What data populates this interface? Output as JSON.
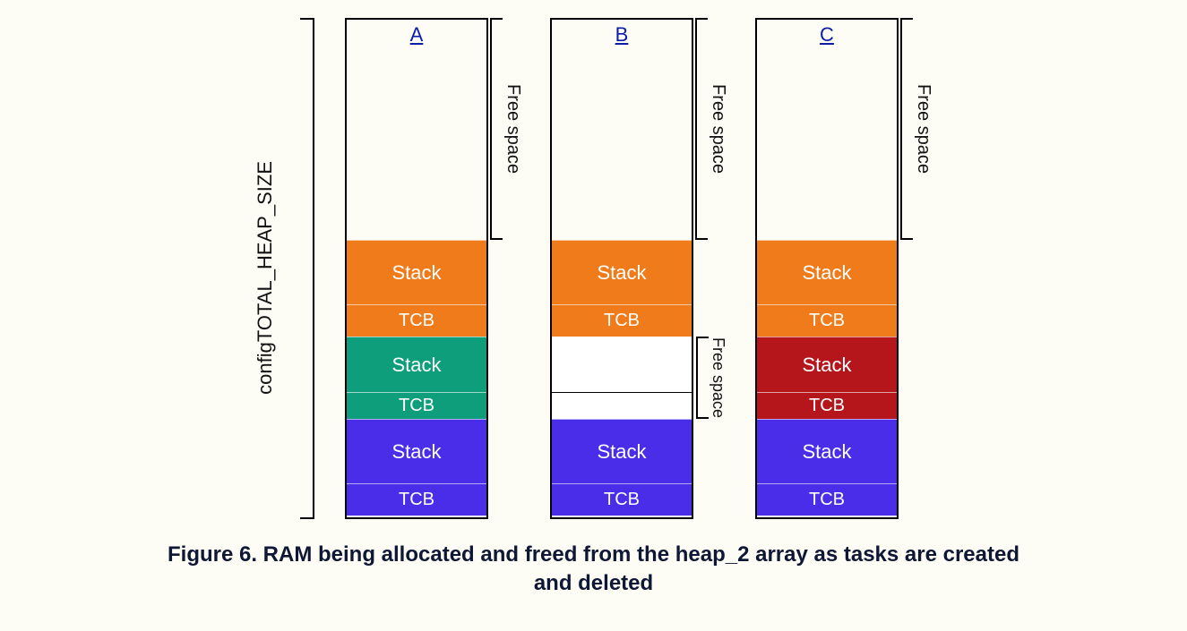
{
  "axis_label": "configTOTAL_HEAP_SIZE",
  "free_label": "Free space",
  "free_label2": "Free space",
  "labels": {
    "stack": "Stack",
    "tcb": "TCB"
  },
  "columns": {
    "a": {
      "title": "A"
    },
    "b": {
      "title": "B"
    },
    "c": {
      "title": "C"
    }
  },
  "caption_line1": "Figure 6.  RAM being allocated and freed from the heap_2 array as tasks are created",
  "caption_line2": "and deleted",
  "chart_data": {
    "type": "table",
    "title": "heap_2 allocation states",
    "columns": [
      {
        "id": "A",
        "segments": [
          {
            "region": "free_top",
            "label": "Free space"
          },
          {
            "region": "task3_stack",
            "label": "Stack",
            "color": "orange"
          },
          {
            "region": "task3_tcb",
            "label": "TCB",
            "color": "orange"
          },
          {
            "region": "task2_stack",
            "label": "Stack",
            "color": "teal"
          },
          {
            "region": "task2_tcb",
            "label": "TCB",
            "color": "teal"
          },
          {
            "region": "task1_stack",
            "label": "Stack",
            "color": "blue"
          },
          {
            "region": "task1_tcb",
            "label": "TCB",
            "color": "blue"
          }
        ]
      },
      {
        "id": "B",
        "segments": [
          {
            "region": "free_top",
            "label": "Free space"
          },
          {
            "region": "task3_stack",
            "label": "Stack",
            "color": "orange"
          },
          {
            "region": "task3_tcb",
            "label": "TCB",
            "color": "orange"
          },
          {
            "region": "free_mid_stack",
            "label": "Free space"
          },
          {
            "region": "free_mid_tcb",
            "label": ""
          },
          {
            "region": "task1_stack",
            "label": "Stack",
            "color": "blue"
          },
          {
            "region": "task1_tcb",
            "label": "TCB",
            "color": "blue"
          }
        ]
      },
      {
        "id": "C",
        "segments": [
          {
            "region": "free_top",
            "label": "Free space"
          },
          {
            "region": "task3_stack",
            "label": "Stack",
            "color": "orange"
          },
          {
            "region": "task3_tcb",
            "label": "TCB",
            "color": "orange"
          },
          {
            "region": "task4_stack",
            "label": "Stack",
            "color": "red"
          },
          {
            "region": "task4_tcb",
            "label": "TCB",
            "color": "red"
          },
          {
            "region": "task1_stack",
            "label": "Stack",
            "color": "blue"
          },
          {
            "region": "task1_tcb",
            "label": "TCB",
            "color": "blue"
          }
        ]
      }
    ]
  }
}
